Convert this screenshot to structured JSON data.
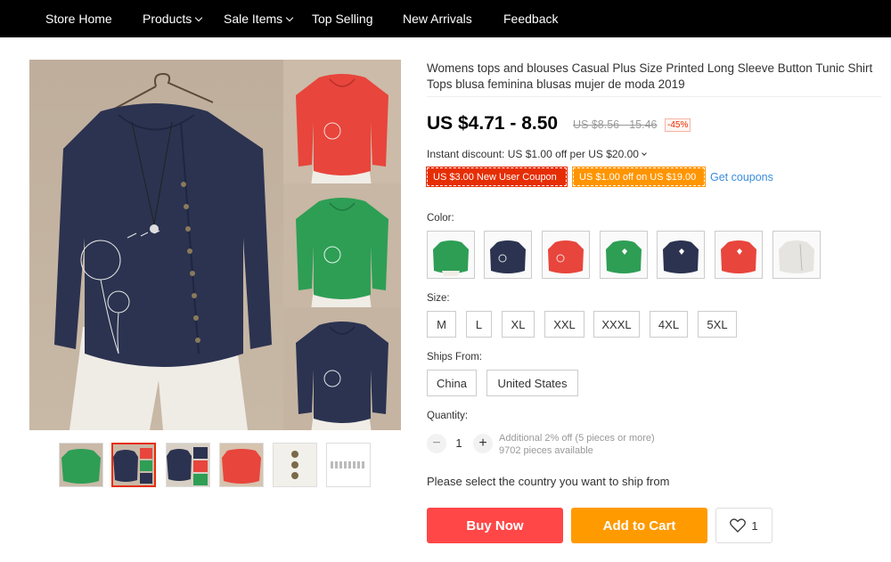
{
  "nav": {
    "items": [
      {
        "label": "Store Home",
        "has_dropdown": false
      },
      {
        "label": "Products",
        "has_dropdown": true
      },
      {
        "label": "Sale Items",
        "has_dropdown": true
      },
      {
        "label": "Top Selling",
        "has_dropdown": false
      },
      {
        "label": "New Arrivals",
        "has_dropdown": false
      },
      {
        "label": "Feedback",
        "has_dropdown": false
      }
    ]
  },
  "gallery": {
    "main_color": "navy",
    "side_colors": [
      "red",
      "green",
      "navy"
    ],
    "thumbnails": [
      "green",
      "navy",
      "navy",
      "red",
      "white-detail",
      "size-chart"
    ],
    "active_thumbnail": 1
  },
  "product": {
    "title": "Womens tops and blouses Casual Plus Size Printed Long Sleeve Button Tunic Shirt Tops blusa feminina blusas mujer de moda 2019",
    "price": "US $4.71 - 8.50",
    "old_price": "US $8.56 - 15.46",
    "discount": "-45%",
    "instant_discount": "Instant discount: US $1.00 off per US $20.00",
    "coupon_new_user": "US $3.00 New User Coupon",
    "coupon_store": "US $1.00 off on US $19.00",
    "get_coupons": "Get coupons"
  },
  "options": {
    "color_label": "Color:",
    "colors": [
      "green",
      "navy",
      "red",
      "green",
      "navy",
      "red",
      "white"
    ],
    "size_label": "Size:",
    "sizes": [
      "M",
      "L",
      "XL",
      "XXL",
      "XXXL",
      "4XL",
      "5XL"
    ],
    "ships_label": "Ships From:",
    "ships_from": [
      "China",
      "United States"
    ],
    "quantity_label": "Quantity:",
    "quantity": "1",
    "quantity_note_1": "Additional 2% off (5 pieces or more)",
    "quantity_note_2": "9702 pieces available"
  },
  "ship_message": "Please select the country you want to ship from",
  "actions": {
    "buy_now": "Buy Now",
    "add_to_cart": "Add to Cart",
    "wishlist_count": "1"
  },
  "colors": {
    "nav_bg": "#000000",
    "price_red": "#e62e04",
    "buy_now": "#ff4747",
    "add_to_cart": "#ff9a00",
    "link_blue": "#3a8ddc"
  }
}
